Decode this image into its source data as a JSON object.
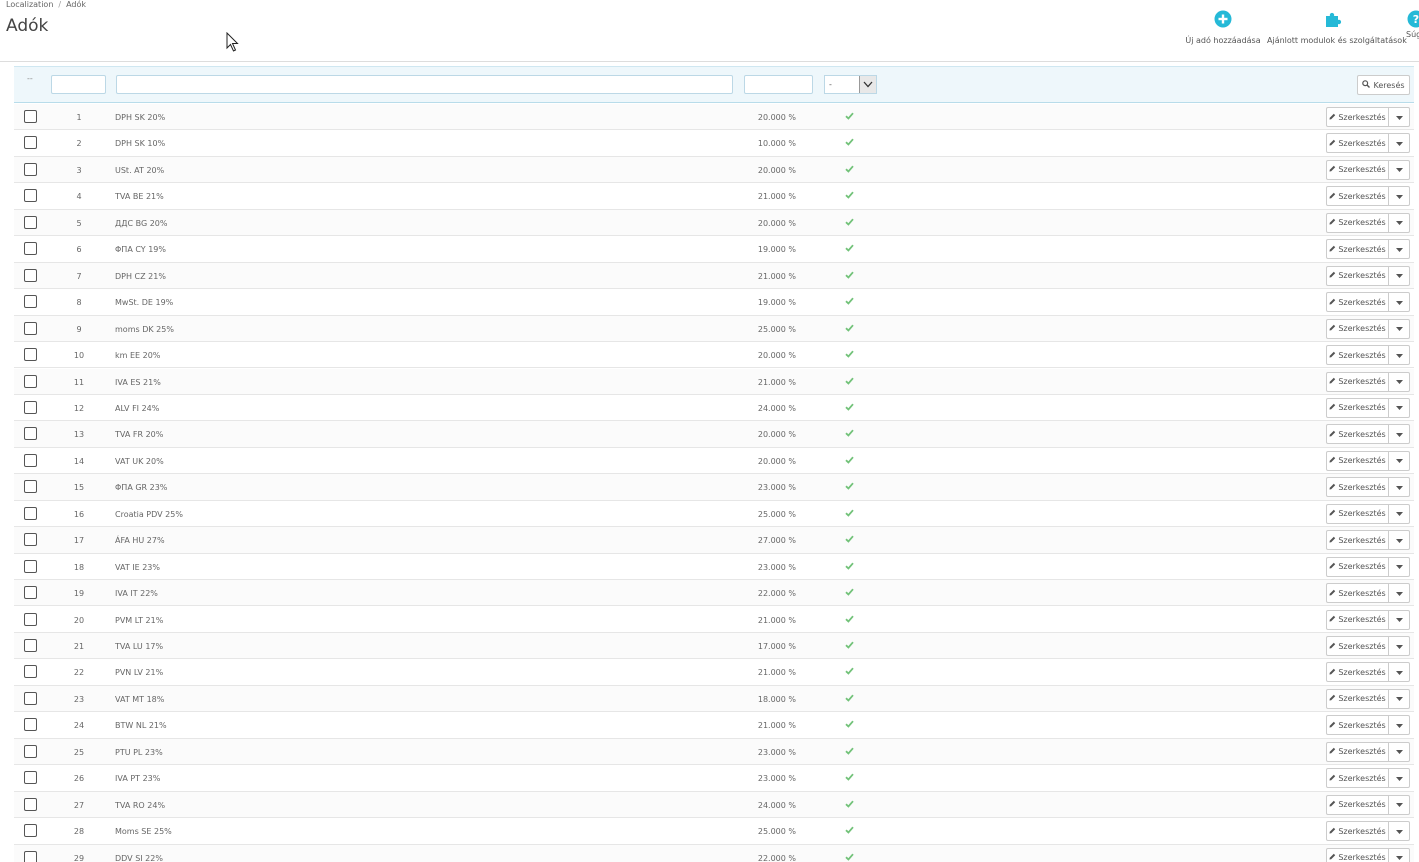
{
  "breadcrumb": {
    "parent": "Localization",
    "current": "Adók"
  },
  "page": {
    "title": "Adók"
  },
  "toolbar": {
    "add_label": "Új adó hozzáadása",
    "modules_label": "Ajánlott modulok és szolgáltatások",
    "help_label": "Súgó",
    "accent_color": "#25b9d7"
  },
  "filters": {
    "sort_indicator": "--",
    "active_select_value": "-",
    "search_label": "Keresés"
  },
  "row_actions": {
    "edit_label": "Szerkesztés"
  },
  "taxes": [
    {
      "id": "1",
      "name": "DPH SK 20%",
      "rate": "20.000 %"
    },
    {
      "id": "2",
      "name": "DPH SK 10%",
      "rate": "10.000 %"
    },
    {
      "id": "3",
      "name": "USt. AT 20%",
      "rate": "20.000 %"
    },
    {
      "id": "4",
      "name": "TVA BE 21%",
      "rate": "21.000 %"
    },
    {
      "id": "5",
      "name": "ДДС BG 20%",
      "rate": "20.000 %"
    },
    {
      "id": "6",
      "name": "ΦΠΑ CY 19%",
      "rate": "19.000 %"
    },
    {
      "id": "7",
      "name": "DPH CZ 21%",
      "rate": "21.000 %"
    },
    {
      "id": "8",
      "name": "MwSt. DE 19%",
      "rate": "19.000 %"
    },
    {
      "id": "9",
      "name": "moms DK 25%",
      "rate": "25.000 %"
    },
    {
      "id": "10",
      "name": "km EE 20%",
      "rate": "20.000 %"
    },
    {
      "id": "11",
      "name": "IVA ES 21%",
      "rate": "21.000 %"
    },
    {
      "id": "12",
      "name": "ALV FI 24%",
      "rate": "24.000 %"
    },
    {
      "id": "13",
      "name": "TVA FR 20%",
      "rate": "20.000 %"
    },
    {
      "id": "14",
      "name": "VAT UK 20%",
      "rate": "20.000 %"
    },
    {
      "id": "15",
      "name": "ΦΠΑ GR 23%",
      "rate": "23.000 %"
    },
    {
      "id": "16",
      "name": "Croatia PDV 25%",
      "rate": "25.000 %"
    },
    {
      "id": "17",
      "name": "ÁFA HU 27%",
      "rate": "27.000 %"
    },
    {
      "id": "18",
      "name": "VAT IE 23%",
      "rate": "23.000 %"
    },
    {
      "id": "19",
      "name": "IVA IT 22%",
      "rate": "22.000 %"
    },
    {
      "id": "20",
      "name": "PVM LT 21%",
      "rate": "21.000 %"
    },
    {
      "id": "21",
      "name": "TVA LU 17%",
      "rate": "17.000 %"
    },
    {
      "id": "22",
      "name": "PVN LV 21%",
      "rate": "21.000 %"
    },
    {
      "id": "23",
      "name": "VAT MT 18%",
      "rate": "18.000 %"
    },
    {
      "id": "24",
      "name": "BTW NL 21%",
      "rate": "21.000 %"
    },
    {
      "id": "25",
      "name": "PTU PL 23%",
      "rate": "23.000 %"
    },
    {
      "id": "26",
      "name": "IVA PT 23%",
      "rate": "23.000 %"
    },
    {
      "id": "27",
      "name": "TVA RO 24%",
      "rate": "24.000 %"
    },
    {
      "id": "28",
      "name": "Moms SE 25%",
      "rate": "25.000 %"
    },
    {
      "id": "29",
      "name": "DDV SI 22%",
      "rate": "22.000 %"
    }
  ],
  "status_color": "#72c279"
}
